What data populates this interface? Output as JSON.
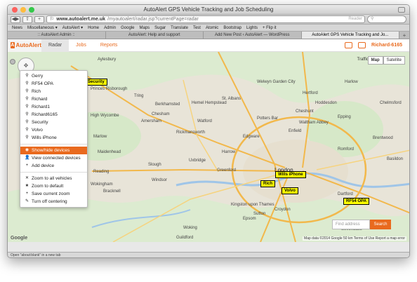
{
  "window": {
    "title": "AutoAlert GPS Vehicle Tracking and Job Scheduling"
  },
  "browser": {
    "url_domain": "www.autoalert.me.uk",
    "url_path": "/myautoalert/radar.jsp?currentPage=radar",
    "reader": "Reader",
    "bookmarks": [
      "News",
      "Miscellaneous ▾",
      "AutoAlert ▾",
      "Home",
      "Admin",
      "Google",
      "Maps",
      "Sugar",
      "Translate",
      "Test",
      "Atomic",
      "Bootstrap",
      "Lights",
      "+ Flip it"
    ],
    "tabs": [
      {
        "label": ":: AutoAlert Admin ::",
        "active": false
      },
      {
        "label": "AutoAlert: Help and support",
        "active": false
      },
      {
        "label": "Add New Post ‹ AutoAlert — WordPress",
        "active": false
      },
      {
        "label": "AutoAlert GPS Vehicle Tracking and Jo...",
        "active": true
      }
    ],
    "status": "Open \"about:blank\" in a new tab"
  },
  "app": {
    "logo": "AutoAlert",
    "nav": [
      {
        "label": "Radar",
        "active": true
      },
      {
        "label": "Jobs",
        "active": false
      },
      {
        "label": "Reports",
        "active": false
      }
    ],
    "user": "Richard-6165"
  },
  "menu": {
    "vehicles": [
      "Gerry",
      "RF54 OPA",
      "Rich",
      "Richard",
      "Richard1",
      "Richard6165",
      "Security",
      "Volvo",
      "Wills iPhone"
    ],
    "devices": [
      {
        "label": "Show/hide devices",
        "icon": "eye-icon",
        "selected": true
      },
      {
        "label": "View connected devices",
        "icon": "person-icon",
        "selected": false
      },
      {
        "label": "Add device",
        "icon": "plus-icon",
        "selected": false
      }
    ],
    "zoom": [
      {
        "label": "Zoom to all vehicles",
        "icon": "expand-icon"
      },
      {
        "label": "Zoom to default",
        "icon": "star-icon"
      },
      {
        "label": "Save current zoom",
        "icon": "plus-icon"
      },
      {
        "label": "Turn off centering",
        "icon": "pin-icon"
      }
    ]
  },
  "map": {
    "type_buttons": [
      "Map",
      "Satellite"
    ],
    "traffic": "Traffic",
    "find_placeholder": "Find address",
    "search_label": "Search",
    "attribution": "Map data ©2014 Google  50 km  Terms of Use  Report a map error",
    "google": "Google",
    "places": [
      {
        "name": "London",
        "major": true
      },
      {
        "name": "Aylesbury"
      },
      {
        "name": "Princes Risborough"
      },
      {
        "name": "High Wycombe"
      },
      {
        "name": "Marlow"
      },
      {
        "name": "Maidenhead"
      },
      {
        "name": "Slough"
      },
      {
        "name": "Windsor"
      },
      {
        "name": "Reading"
      },
      {
        "name": "Bracknell"
      },
      {
        "name": "Wokingham"
      },
      {
        "name": "Watford"
      },
      {
        "name": "St. Albans"
      },
      {
        "name": "Hemel Hempstead"
      },
      {
        "name": "Welwyn Garden City"
      },
      {
        "name": "Hertford"
      },
      {
        "name": "Hoddesdon"
      },
      {
        "name": "Harlow"
      },
      {
        "name": "Epping"
      },
      {
        "name": "Brentwood"
      },
      {
        "name": "Basildon"
      },
      {
        "name": "Chelmsford"
      },
      {
        "name": "Romford"
      },
      {
        "name": "Dartford"
      },
      {
        "name": "Edgware"
      },
      {
        "name": "Harrow"
      },
      {
        "name": "Uxbridge"
      },
      {
        "name": "Enfield"
      },
      {
        "name": "Greenford"
      },
      {
        "name": "Kingston upon Thames"
      },
      {
        "name": "Croydon"
      },
      {
        "name": "Epsom"
      },
      {
        "name": "Sutton"
      },
      {
        "name": "Woking"
      },
      {
        "name": "Guildford"
      },
      {
        "name": "Sevenoaks"
      },
      {
        "name": "Amersham"
      },
      {
        "name": "Rickmansworth"
      },
      {
        "name": "Potters Bar"
      },
      {
        "name": "Cheshunt"
      },
      {
        "name": "Waltham Abbey"
      },
      {
        "name": "Berkhamsted"
      },
      {
        "name": "Tring"
      },
      {
        "name": "Chesham"
      }
    ],
    "vehicles": [
      {
        "name": "Security"
      },
      {
        "name": "Wills iPhone"
      },
      {
        "name": "Rich"
      },
      {
        "name": "Volvo"
      },
      {
        "name": "RF54 OPA"
      }
    ]
  }
}
